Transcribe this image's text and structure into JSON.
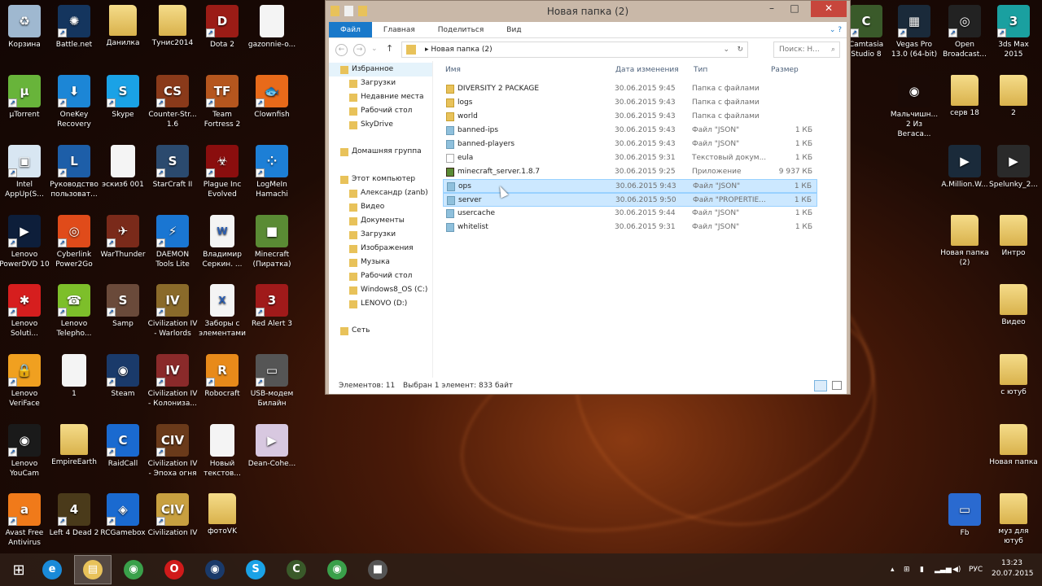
{
  "desktop": {
    "icons": [
      {
        "label": "Корзина",
        "kind": "app",
        "color": "#9fb8d0",
        "glyph": "♻"
      },
      {
        "label": "Battle.net",
        "kind": "app",
        "color": "#14355e",
        "glyph": "✺",
        "sc": true
      },
      {
        "label": "Данилка",
        "kind": "folder"
      },
      {
        "label": "Тунис2014",
        "kind": "folder"
      },
      {
        "label": "Dota 2",
        "kind": "app",
        "color": "#9b1c16",
        "glyph": "D",
        "sc": true
      },
      {
        "label": "gazonnie-o...",
        "kind": "doc",
        "glyph": ""
      },
      {
        "label": "µTorrent",
        "kind": "app",
        "color": "#68b43a",
        "glyph": "µ",
        "sc": true
      },
      {
        "label": "OneKey Recovery",
        "kind": "app",
        "color": "#1c86d6",
        "glyph": "⬇",
        "sc": true
      },
      {
        "label": "Skype",
        "kind": "app",
        "color": "#1aa2e6",
        "glyph": "S",
        "sc": true
      },
      {
        "label": "Counter-Str... 1.6",
        "kind": "app",
        "color": "#8a3a1a",
        "glyph": "CS",
        "sc": true
      },
      {
        "label": "Team Fortress 2",
        "kind": "app",
        "color": "#b5561e",
        "glyph": "TF",
        "sc": true
      },
      {
        "label": "Clownfish",
        "kind": "app",
        "color": "#e86a1a",
        "glyph": "🐟",
        "sc": true
      },
      {
        "label": "Intel AppUp(S...",
        "kind": "app",
        "color": "#d8e6f2",
        "glyph": "▣",
        "sc": true
      },
      {
        "label": "Руководство пользоват...",
        "kind": "app",
        "color": "#1d5ea8",
        "glyph": "L",
        "sc": true
      },
      {
        "label": "эскиз6 001",
        "kind": "doc",
        "glyph": ""
      },
      {
        "label": "StarCraft II",
        "kind": "app",
        "color": "#2b4a6e",
        "glyph": "S",
        "sc": true
      },
      {
        "label": "Plague Inc Evolved",
        "kind": "app",
        "color": "#8a0e0e",
        "glyph": "☣",
        "sc": true
      },
      {
        "label": "LogMeIn Hamachi",
        "kind": "app",
        "color": "#1d7fd6",
        "glyph": "⁘",
        "sc": true
      },
      {
        "label": "Lenovo PowerDVD 10",
        "kind": "app",
        "color": "#0d1e3a",
        "glyph": "▶",
        "sc": true
      },
      {
        "label": "Cyberlink Power2Go",
        "kind": "app",
        "color": "#e04b1a",
        "glyph": "◎",
        "sc": true
      },
      {
        "label": "WarThunder",
        "kind": "app",
        "color": "#7a2a1a",
        "glyph": "✈",
        "sc": true
      },
      {
        "label": "DAEMON Tools Lite",
        "kind": "app",
        "color": "#1a76d2",
        "glyph": "⚡",
        "sc": true
      },
      {
        "label": "Владимир Серкин. ...",
        "kind": "doc",
        "glyph": "W"
      },
      {
        "label": "Minecraft (Пиратка)",
        "kind": "app",
        "color": "#5a8b34",
        "glyph": "■"
      },
      {
        "label": "Lenovo Soluti...",
        "kind": "app",
        "color": "#d61e1e",
        "glyph": "✱",
        "sc": true
      },
      {
        "label": "Lenovo Telepho...",
        "kind": "app",
        "color": "#7dbf2a",
        "glyph": "☎",
        "sc": true
      },
      {
        "label": "Samp",
        "kind": "app",
        "color": "#6a4a3a",
        "glyph": "S",
        "sc": true
      },
      {
        "label": "Civilization IV - Warlords",
        "kind": "app",
        "color": "#8a6a2a",
        "glyph": "IV",
        "sc": true
      },
      {
        "label": "Заборы с элементами",
        "kind": "doc",
        "glyph": "X"
      },
      {
        "label": "Red Alert 3",
        "kind": "app",
        "color": "#a01a1a",
        "glyph": "3",
        "sc": true
      },
      {
        "label": "Lenovo VeriFace",
        "kind": "app",
        "color": "#f0a020",
        "glyph": "🔒",
        "sc": true
      },
      {
        "label": "1",
        "kind": "doc",
        "glyph": ""
      },
      {
        "label": "Steam",
        "kind": "app",
        "color": "#1a3a6a",
        "glyph": "◉",
        "sc": true
      },
      {
        "label": "Civilization IV - Колониза...",
        "kind": "app",
        "color": "#8a2a2a",
        "glyph": "IV",
        "sc": true
      },
      {
        "label": "Robocraft",
        "kind": "app",
        "color": "#e88a1a",
        "glyph": "R",
        "sc": true
      },
      {
        "label": "USB-модем Билайн",
        "kind": "app",
        "color": "#555",
        "glyph": "▭",
        "sc": true
      },
      {
        "label": "Lenovo YouCam",
        "kind": "app",
        "color": "#1a1a1a",
        "glyph": "◉",
        "sc": true
      },
      {
        "label": "EmpireEarth",
        "kind": "folder"
      },
      {
        "label": "RaidCall",
        "kind": "app",
        "color": "#1a6ad0",
        "glyph": "C",
        "sc": true
      },
      {
        "label": "Civilization IV - Эпоха огня",
        "kind": "app",
        "color": "#6a3a1a",
        "glyph": "CIV",
        "sc": true
      },
      {
        "label": "Новый текстов...",
        "kind": "doc",
        "glyph": ""
      },
      {
        "label": "Dean-Cohe...",
        "kind": "app",
        "color": "#d8c8e0",
        "glyph": "▶"
      },
      {
        "label": "Avast Free Antivirus",
        "kind": "app",
        "color": "#f07a1a",
        "glyph": "a",
        "sc": true
      },
      {
        "label": "Left 4 Dead 2",
        "kind": "app",
        "color": "#4a3a1a",
        "glyph": "4",
        "sc": true
      },
      {
        "label": "RCGamebox",
        "kind": "app",
        "color": "#1a6ad0",
        "glyph": "◈",
        "sc": true
      },
      {
        "label": "Civilization IV",
        "kind": "app",
        "color": "#c8a040",
        "glyph": "CIV",
        "sc": true
      },
      {
        "label": "фотоVK",
        "kind": "folder"
      }
    ],
    "right_icons": [
      {
        "label": "Camtasia Studio 8",
        "kind": "app",
        "color": "#3a5a2a",
        "glyph": "C",
        "sc": true
      },
      {
        "label": "Vegas Pro 13.0 (64-bit)",
        "kind": "app",
        "color": "#1a2a3a",
        "glyph": "▦",
        "sc": true
      },
      {
        "label": "Open Broadcast...",
        "kind": "app",
        "color": "#222",
        "glyph": "◎",
        "sc": true
      },
      {
        "label": "3ds Max 2015",
        "kind": "app",
        "color": "#1aa0a0",
        "glyph": "3",
        "sc": true
      },
      {
        "label": "Мальчишн... 2 Из Вегаса...",
        "kind": "app",
        "color": "#1a0a06",
        "glyph": "◉"
      },
      {
        "label": "серв 18",
        "kind": "folder"
      },
      {
        "label": "2",
        "kind": "folder"
      },
      {
        "label": "A.Million.W...",
        "kind": "app",
        "color": "#1a2a3a",
        "glyph": "▶"
      },
      {
        "label": "Spelunky_2...",
        "kind": "app",
        "color": "#2a2a2a",
        "glyph": "▶"
      },
      {
        "label": "Новая папка (2)",
        "kind": "folder"
      },
      {
        "label": "Интро",
        "kind": "folder"
      },
      {
        "label": "Видео",
        "kind": "folder"
      },
      {
        "label": "с ютуб",
        "kind": "folder"
      },
      {
        "label": "Новая папка",
        "kind": "folder"
      },
      {
        "label": "Fb",
        "kind": "app",
        "color": "#2a6ad0",
        "glyph": "▭"
      },
      {
        "label": "муз для ютуб",
        "kind": "folder"
      }
    ]
  },
  "explorer": {
    "title": "Новая папка (2)",
    "ribbon_tabs": [
      "Файл",
      "Главная",
      "Поделиться",
      "Вид"
    ],
    "address": "Новая папка (2)",
    "search_placeholder": "Поиск: Н...",
    "columns": [
      "Имя",
      "Дата изменения",
      "Тип",
      "Размер"
    ],
    "nav": [
      {
        "label": "Избранное",
        "level": 0
      },
      {
        "label": "Загрузки",
        "level": 1
      },
      {
        "label": "Недавние места",
        "level": 1
      },
      {
        "label": "Рабочий стол",
        "level": 1
      },
      {
        "label": "SkyDrive",
        "level": 1
      },
      {
        "label": "Домашняя группа",
        "level": 0
      },
      {
        "label": "Этот компьютер",
        "level": 0
      },
      {
        "label": "Александр (zanb)",
        "level": 1
      },
      {
        "label": "Видео",
        "level": 1
      },
      {
        "label": "Документы",
        "level": 1
      },
      {
        "label": "Загрузки",
        "level": 1
      },
      {
        "label": "Изображения",
        "level": 1
      },
      {
        "label": "Музыка",
        "level": 1
      },
      {
        "label": "Рабочий стол",
        "level": 1
      },
      {
        "label": "Windows8_OS (C:)",
        "level": 1
      },
      {
        "label": "LENOVO (D:)",
        "level": 1
      },
      {
        "label": "Сеть",
        "level": 0
      }
    ],
    "files": [
      {
        "name": "DIVERSITY 2 PACKAGE",
        "date": "30.06.2015 9:45",
        "type": "Папка с файлами",
        "size": "",
        "icon": "folder"
      },
      {
        "name": "logs",
        "date": "30.06.2015 9:43",
        "type": "Папка с файлами",
        "size": "",
        "icon": "folder"
      },
      {
        "name": "world",
        "date": "30.06.2015 9:43",
        "type": "Папка с файлами",
        "size": "",
        "icon": "folder"
      },
      {
        "name": "banned-ips",
        "date": "30.06.2015 9:43",
        "type": "Файл \"JSON\"",
        "size": "1 КБ",
        "icon": "file"
      },
      {
        "name": "banned-players",
        "date": "30.06.2015 9:43",
        "type": "Файл \"JSON\"",
        "size": "1 КБ",
        "icon": "file"
      },
      {
        "name": "eula",
        "date": "30.06.2015 9:31",
        "type": "Текстовый докум...",
        "size": "1 КБ",
        "icon": "text"
      },
      {
        "name": "minecraft_server.1.8.7",
        "date": "30.06.2015 9:25",
        "type": "Приложение",
        "size": "9 937 КБ",
        "icon": "app"
      },
      {
        "name": "ops",
        "date": "30.06.2015 9:43",
        "type": "Файл \"JSON\"",
        "size": "1 КБ",
        "icon": "file",
        "selected": true
      },
      {
        "name": "server",
        "date": "30.06.2015 9:50",
        "type": "Файл \"PROPERTIE...",
        "size": "1 КБ",
        "icon": "file",
        "selected": true
      },
      {
        "name": "usercache",
        "date": "30.06.2015 9:44",
        "type": "Файл \"JSON\"",
        "size": "1 КБ",
        "icon": "file"
      },
      {
        "name": "whitelist",
        "date": "30.06.2015 9:31",
        "type": "Файл \"JSON\"",
        "size": "1 КБ",
        "icon": "file"
      }
    ],
    "status_count": "Элементов: 11",
    "status_selected": "Выбран 1 элемент: 833 байт"
  },
  "taskbar": {
    "apps": [
      {
        "name": "internet-explorer",
        "color": "#1a8ad8",
        "glyph": "e"
      },
      {
        "name": "file-explorer",
        "color": "#e8c25a",
        "glyph": "▤",
        "active": true
      },
      {
        "name": "chrome",
        "color": "#3aa04a",
        "glyph": "◉"
      },
      {
        "name": "opera",
        "color": "#d01a1a",
        "glyph": "O"
      },
      {
        "name": "steam",
        "color": "#1a3a6a",
        "glyph": "◉"
      },
      {
        "name": "skype",
        "color": "#1aa2e6",
        "glyph": "S"
      },
      {
        "name": "camtasia",
        "color": "#3a5a2a",
        "glyph": "C"
      },
      {
        "name": "chrome-app",
        "color": "#3aa04a",
        "glyph": "◉"
      },
      {
        "name": "minecraft-server",
        "color": "#555",
        "glyph": "■"
      }
    ],
    "language": "РУС",
    "time": "13:23",
    "date": "20.07.2015"
  }
}
